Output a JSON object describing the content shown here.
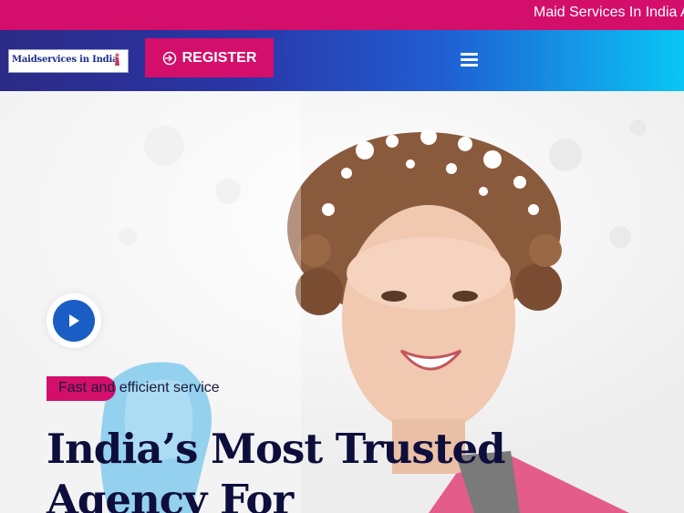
{
  "topbar": {
    "marquee_text": "Maid Services In India Available"
  },
  "header": {
    "logo_text": "Maidservices in India",
    "register_label": "REGISTER",
    "icons": {
      "register": "sign-in-icon",
      "menu": "hamburger-menu-icon"
    }
  },
  "hero": {
    "tagline": "Fast and efficient service",
    "heading": "India’s Most Trusted Agency For",
    "icons": {
      "play": "play-icon"
    }
  },
  "colors": {
    "accent_pink": "#d30e6b",
    "header_gradient_start": "#2b2a86",
    "header_gradient_end": "#09c6f5",
    "play_blue": "#1a5dc4",
    "heading_navy": "#0e0e3c"
  }
}
